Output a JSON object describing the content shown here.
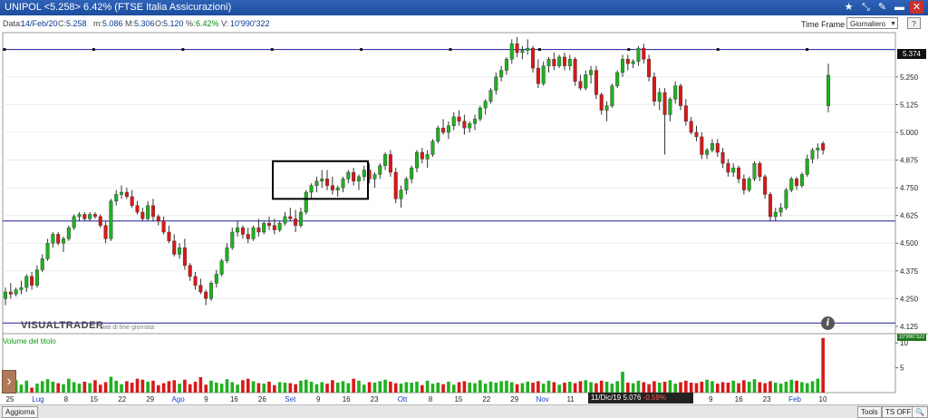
{
  "window": {
    "title": "UNIPOL <5.258> 6.42% (FTSE Italia Assicurazioni)",
    "controls": [
      "★",
      "⤡",
      "✎",
      "▬",
      "✕"
    ]
  },
  "info_bar": {
    "date_label": "Data:",
    "date": "14/Feb/20",
    "close_label": "C:",
    "close": "5.258",
    "min_label": "m:",
    "min": "5.086",
    "max_label": "M:",
    "max": "5.306",
    "open_label": "O:",
    "open": "5.120",
    "pct_label": "%:",
    "pct": "6.42%",
    "vol_label": "V:",
    "vol": "10'990'322"
  },
  "time_frame": {
    "label": "Time Frame",
    "value": "Giornaliero",
    "help": "?"
  },
  "branding": {
    "name": "VISUALTRADER",
    "subtitle": "Dati di fine giornata"
  },
  "volume_panel": {
    "label": "Volume del titolo",
    "last_value": "10'990'322"
  },
  "last_price_label": "5.374",
  "tooltip": {
    "date": "11/Dic/19",
    "price": "5.076",
    "change": "-0.59%"
  },
  "status_bar": {
    "refresh": "Aggiorna",
    "tools": "Tools",
    "ts": "TS OFF",
    "zoom": "🔍"
  },
  "colors": {
    "up": "#20b020",
    "down": "#d81818",
    "ref_line": "#1d1d9e",
    "box": "#000000"
  },
  "chart_data": {
    "type": "candlestick",
    "title": "UNIPOL",
    "ylim": [
      4.1,
      5.45
    ],
    "y_ticks": [
      "5.250",
      "5.125",
      "5.000",
      "4.875",
      "4.750",
      "4.625",
      "4.500",
      "4.375",
      "4.250",
      "4.125"
    ],
    "x_labels": [
      "25",
      "Lug",
      "8",
      "15",
      "22",
      "29",
      "Ago",
      "9",
      "16",
      "26",
      "Set",
      "9",
      "16",
      "23",
      "Ott",
      "8",
      "15",
      "22",
      "29",
      "Nov",
      "11",
      "18",
      "25",
      "Dic",
      "20",
      "9",
      "16",
      "23",
      "Feb",
      "10"
    ],
    "x_label_blue": [
      "Lug",
      "Ago",
      "Set",
      "Ott",
      "Nov",
      "Dic",
      "Feb"
    ],
    "horizontal_lines": [
      5.374,
      4.6,
      4.14
    ],
    "highlight_box": {
      "x_range": [
        "16 Set",
        "Ott"
      ],
      "y_range": [
        4.7,
        4.87
      ]
    },
    "candles": [
      [
        4.25,
        4.3,
        4.22,
        4.28
      ],
      [
        4.28,
        4.32,
        4.25,
        4.27
      ],
      [
        4.27,
        4.3,
        4.26,
        4.29
      ],
      [
        4.29,
        4.33,
        4.27,
        4.3
      ],
      [
        4.3,
        4.36,
        4.28,
        4.35
      ],
      [
        4.35,
        4.37,
        4.29,
        4.31
      ],
      [
        4.31,
        4.4,
        4.3,
        4.38
      ],
      [
        4.38,
        4.45,
        4.37,
        4.43
      ],
      [
        4.43,
        4.52,
        4.42,
        4.5
      ],
      [
        4.5,
        4.55,
        4.48,
        4.54
      ],
      [
        4.54,
        4.55,
        4.49,
        4.5
      ],
      [
        4.5,
        4.53,
        4.46,
        4.52
      ],
      [
        4.52,
        4.58,
        4.51,
        4.57
      ],
      [
        4.57,
        4.63,
        4.56,
        4.62
      ],
      [
        4.62,
        4.64,
        4.6,
        4.63
      ],
      [
        4.63,
        4.64,
        4.6,
        4.61
      ],
      [
        4.61,
        4.64,
        4.6,
        4.63
      ],
      [
        4.63,
        4.64,
        4.61,
        4.62
      ],
      [
        4.62,
        4.63,
        4.57,
        4.58
      ],
      [
        4.58,
        4.6,
        4.5,
        4.52
      ],
      [
        4.52,
        4.7,
        4.51,
        4.69
      ],
      [
        4.69,
        4.74,
        4.67,
        4.72
      ],
      [
        4.72,
        4.76,
        4.7,
        4.73
      ],
      [
        4.73,
        4.75,
        4.7,
        4.71
      ],
      [
        4.71,
        4.74,
        4.66,
        4.67
      ],
      [
        4.67,
        4.69,
        4.63,
        4.64
      ],
      [
        4.64,
        4.66,
        4.6,
        4.61
      ],
      [
        4.61,
        4.69,
        4.6,
        4.67
      ],
      [
        4.67,
        4.7,
        4.6,
        4.62
      ],
      [
        4.62,
        4.63,
        4.58,
        4.6
      ],
      [
        4.6,
        4.62,
        4.54,
        4.55
      ],
      [
        4.55,
        4.58,
        4.5,
        4.51
      ],
      [
        4.51,
        4.54,
        4.44,
        4.45
      ],
      [
        4.45,
        4.5,
        4.43,
        4.48
      ],
      [
        4.48,
        4.52,
        4.38,
        4.4
      ],
      [
        4.4,
        4.41,
        4.33,
        4.35
      ],
      [
        4.35,
        4.37,
        4.29,
        4.31
      ],
      [
        4.31,
        4.34,
        4.27,
        4.28
      ],
      [
        4.28,
        4.29,
        4.22,
        4.25
      ],
      [
        4.25,
        4.33,
        4.24,
        4.32
      ],
      [
        4.32,
        4.38,
        4.3,
        4.36
      ],
      [
        4.36,
        4.43,
        4.35,
        4.42
      ],
      [
        4.42,
        4.5,
        4.41,
        4.48
      ],
      [
        4.48,
        4.57,
        4.47,
        4.55
      ],
      [
        4.55,
        4.6,
        4.53,
        4.57
      ],
      [
        4.57,
        4.58,
        4.52,
        4.54
      ],
      [
        4.54,
        4.57,
        4.5,
        4.52
      ],
      [
        4.52,
        4.58,
        4.51,
        4.57
      ],
      [
        4.57,
        4.61,
        4.53,
        4.55
      ],
      [
        4.55,
        4.6,
        4.54,
        4.59
      ],
      [
        4.59,
        4.62,
        4.56,
        4.58
      ],
      [
        4.58,
        4.61,
        4.54,
        4.56
      ],
      [
        4.56,
        4.6,
        4.55,
        4.59
      ],
      [
        4.59,
        4.64,
        4.58,
        4.62
      ],
      [
        4.62,
        4.66,
        4.6,
        4.61
      ],
      [
        4.61,
        4.65,
        4.55,
        4.58
      ],
      [
        4.58,
        4.66,
        4.57,
        4.64
      ],
      [
        4.64,
        4.74,
        4.63,
        4.73
      ],
      [
        4.73,
        4.77,
        4.7,
        4.76
      ],
      [
        4.76,
        4.8,
        4.73,
        4.78
      ],
      [
        4.78,
        4.83,
        4.75,
        4.79
      ],
      [
        4.79,
        4.83,
        4.74,
        4.76
      ],
      [
        4.76,
        4.8,
        4.72,
        4.74
      ],
      [
        4.74,
        4.76,
        4.71,
        4.75
      ],
      [
        4.75,
        4.8,
        4.73,
        4.79
      ],
      [
        4.79,
        4.83,
        4.77,
        4.82
      ],
      [
        4.82,
        4.84,
        4.76,
        4.78
      ],
      [
        4.78,
        4.81,
        4.74,
        4.8
      ],
      [
        4.8,
        4.85,
        4.78,
        4.83
      ],
      [
        4.83,
        4.86,
        4.77,
        4.79
      ],
      [
        4.79,
        4.82,
        4.75,
        4.81
      ],
      [
        4.81,
        4.86,
        4.79,
        4.85
      ],
      [
        4.85,
        4.91,
        4.83,
        4.9
      ],
      [
        4.9,
        4.92,
        4.8,
        4.82
      ],
      [
        4.82,
        4.84,
        4.68,
        4.7
      ],
      [
        4.7,
        4.76,
        4.66,
        4.74
      ],
      [
        4.74,
        4.8,
        4.72,
        4.79
      ],
      [
        4.79,
        4.85,
        4.77,
        4.84
      ],
      [
        4.84,
        4.92,
        4.82,
        4.91
      ],
      [
        4.91,
        4.93,
        4.86,
        4.88
      ],
      [
        4.88,
        4.92,
        4.84,
        4.9
      ],
      [
        4.9,
        4.97,
        4.89,
        4.96
      ],
      [
        4.96,
        5.03,
        4.95,
        5.02
      ],
      [
        5.02,
        5.06,
        4.99,
        5.0
      ],
      [
        5.0,
        5.05,
        4.97,
        5.03
      ],
      [
        5.03,
        5.09,
        5.01,
        5.07
      ],
      [
        5.07,
        5.1,
        5.03,
        5.05
      ],
      [
        5.05,
        5.08,
        4.99,
        5.02
      ],
      [
        5.02,
        5.05,
        5.0,
        5.04
      ],
      [
        5.04,
        5.08,
        5.01,
        5.06
      ],
      [
        5.06,
        5.12,
        5.05,
        5.11
      ],
      [
        5.11,
        5.15,
        5.08,
        5.14
      ],
      [
        5.14,
        5.2,
        5.13,
        5.19
      ],
      [
        5.19,
        5.27,
        5.17,
        5.25
      ],
      [
        5.25,
        5.3,
        5.23,
        5.28
      ],
      [
        5.28,
        5.34,
        5.26,
        5.33
      ],
      [
        5.33,
        5.42,
        5.31,
        5.4
      ],
      [
        5.4,
        5.43,
        5.34,
        5.36
      ],
      [
        5.36,
        5.39,
        5.33,
        5.37
      ],
      [
        5.37,
        5.42,
        5.35,
        5.38
      ],
      [
        5.38,
        5.39,
        5.27,
        5.29
      ],
      [
        5.29,
        5.33,
        5.2,
        5.22
      ],
      [
        5.22,
        5.32,
        5.21,
        5.3
      ],
      [
        5.3,
        5.34,
        5.27,
        5.33
      ],
      [
        5.33,
        5.36,
        5.28,
        5.3
      ],
      [
        5.3,
        5.35,
        5.29,
        5.34
      ],
      [
        5.34,
        5.36,
        5.28,
        5.3
      ],
      [
        5.3,
        5.35,
        5.28,
        5.33
      ],
      [
        5.33,
        5.34,
        5.21,
        5.23
      ],
      [
        5.23,
        5.26,
        5.19,
        5.2
      ],
      [
        5.2,
        5.28,
        5.19,
        5.26
      ],
      [
        5.26,
        5.3,
        5.22,
        5.28
      ],
      [
        5.28,
        5.3,
        5.15,
        5.17
      ],
      [
        5.17,
        5.18,
        5.08,
        5.1
      ],
      [
        5.1,
        5.14,
        5.05,
        5.12
      ],
      [
        5.12,
        5.22,
        5.11,
        5.21
      ],
      [
        5.21,
        5.28,
        5.2,
        5.27
      ],
      [
        5.27,
        5.35,
        5.25,
        5.33
      ],
      [
        5.33,
        5.35,
        5.28,
        5.31
      ],
      [
        5.31,
        5.33,
        5.29,
        5.32
      ],
      [
        5.32,
        5.39,
        5.3,
        5.38
      ],
      [
        5.38,
        5.4,
        5.31,
        5.33
      ],
      [
        5.33,
        5.35,
        5.23,
        5.25
      ],
      [
        5.25,
        5.27,
        5.12,
        5.14
      ],
      [
        5.14,
        5.2,
        5.1,
        5.18
      ],
      [
        5.18,
        5.2,
        4.9,
        5.08
      ],
      [
        5.08,
        5.16,
        5.05,
        5.15
      ],
      [
        5.15,
        5.23,
        5.13,
        5.21
      ],
      [
        5.21,
        5.22,
        5.1,
        5.12
      ],
      [
        5.12,
        5.15,
        5.03,
        5.05
      ],
      [
        5.05,
        5.07,
        4.99,
        5.0
      ],
      [
        5.0,
        5.03,
        4.96,
        4.98
      ],
      [
        4.98,
        5.0,
        4.88,
        4.9
      ],
      [
        4.9,
        4.93,
        4.88,
        4.92
      ],
      [
        4.92,
        4.97,
        4.91,
        4.95
      ],
      [
        4.95,
        4.97,
        4.89,
        4.91
      ],
      [
        4.91,
        4.93,
        4.84,
        4.86
      ],
      [
        4.86,
        4.88,
        4.8,
        4.82
      ],
      [
        4.82,
        4.86,
        4.8,
        4.84
      ],
      [
        4.84,
        4.85,
        4.77,
        4.79
      ],
      [
        4.79,
        4.81,
        4.72,
        4.74
      ],
      [
        4.74,
        4.8,
        4.73,
        4.79
      ],
      [
        4.79,
        4.87,
        4.78,
        4.86
      ],
      [
        4.86,
        4.87,
        4.78,
        4.8
      ],
      [
        4.8,
        4.81,
        4.7,
        4.72
      ],
      [
        4.72,
        4.73,
        4.6,
        4.62
      ],
      [
        4.62,
        4.66,
        4.6,
        4.64
      ],
      [
        4.64,
        4.68,
        4.62,
        4.66
      ],
      [
        4.66,
        4.75,
        4.65,
        4.74
      ],
      [
        4.74,
        4.8,
        4.73,
        4.79
      ],
      [
        4.79,
        4.8,
        4.74,
        4.76
      ],
      [
        4.76,
        4.82,
        4.75,
        4.81
      ],
      [
        4.81,
        4.9,
        4.8,
        4.88
      ],
      [
        4.88,
        4.93,
        4.86,
        4.92
      ],
      [
        4.92,
        4.95,
        4.88,
        4.93
      ],
      [
        4.95,
        4.96,
        4.9,
        4.92
      ],
      [
        5.12,
        5.31,
        5.09,
        5.258
      ]
    ],
    "volumes": [
      2.2,
      0.6,
      2.5,
      1.6,
      2.4,
      1.0,
      1.8,
      2.3,
      2.7,
      2.2,
      1.9,
      1.7,
      2.8,
      2.1,
      1.8,
      2.2,
      1.9,
      2.5,
      1.6,
      2.1,
      3.2,
      2.4,
      1.7,
      2.3,
      2.0,
      2.8,
      2.6,
      2.2,
      2.4,
      1.5,
      1.9,
      2.3,
      2.5,
      1.8,
      2.6,
      1.7,
      2.2,
      3.1,
      1.6,
      2.4,
      2.0,
      1.8,
      2.7,
      2.1,
      1.6,
      2.5,
      2.8,
      2.3,
      1.9,
      1.8,
      2.2,
      1.5,
      2.1,
      2.0,
      1.9,
      1.7,
      2.4,
      2.6,
      2.2,
      1.7,
      2.1,
      1.8,
      2.5,
      2.0,
      2.3,
      1.9,
      2.8,
      2.4,
      1.6,
      2.1,
      2.0,
      2.3,
      2.6,
      2.2,
      1.9,
      1.8,
      2.1,
      2.0,
      2.2,
      1.5,
      2.4,
      1.8,
      2.0,
      1.7,
      2.2,
      1.6,
      2.1,
      2.3,
      2.0,
      1.9,
      2.5,
      1.8,
      2.2,
      2.0,
      2.3,
      2.4,
      2.1,
      1.7,
      1.9,
      2.2,
      2.0,
      2.3,
      1.8,
      2.4,
      2.1,
      1.6,
      2.0,
      2.2,
      1.9,
      2.3,
      2.5,
      2.1,
      1.9,
      2.4,
      2.2,
      1.8,
      2.3,
      4.2,
      2.0,
      1.9,
      2.4,
      2.1,
      1.7,
      2.3,
      2.0,
      2.2,
      2.5,
      1.8,
      2.1,
      2.4,
      2.0,
      1.9,
      2.2,
      2.6,
      2.3,
      1.8,
      2.1,
      2.0,
      2.4,
      1.9,
      2.5,
      2.2,
      2.7,
      2.1,
      1.9,
      2.3,
      2.0,
      1.8,
      2.2,
      2.6,
      2.4,
      2.1,
      1.9,
      2.3,
      2.8,
      11.0
    ]
  }
}
